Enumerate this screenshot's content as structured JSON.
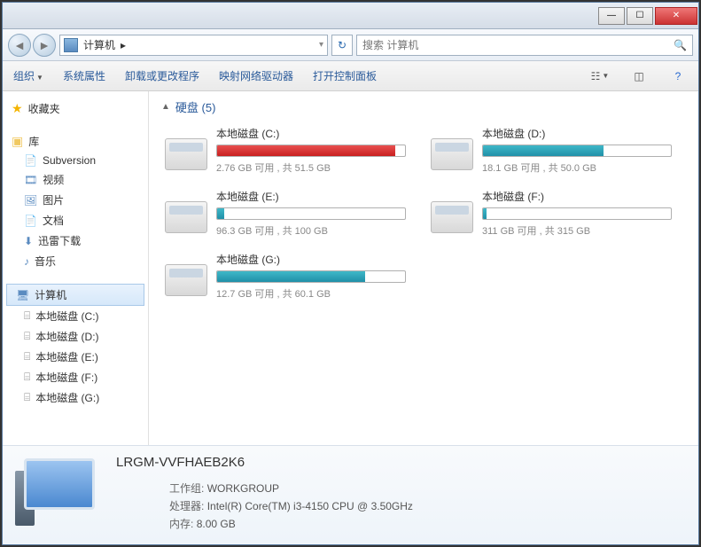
{
  "titlebar": {
    "min": "—",
    "max": "☐",
    "close": "✕"
  },
  "nav": {
    "address_icon": "computer",
    "address_text": "计算机",
    "address_sep": "▸",
    "refresh": "↻",
    "search_placeholder": "搜索 计算机"
  },
  "toolbar": {
    "organize": "组织",
    "properties": "系统属性",
    "uninstall": "卸载或更改程序",
    "map_drive": "映射网络驱动器",
    "control_panel": "打开控制面板"
  },
  "sidebar": {
    "favorites": "收藏夹",
    "libraries": "库",
    "lib_items": [
      {
        "label": "Subversion",
        "icon": "doc"
      },
      {
        "label": "视频",
        "icon": "video"
      },
      {
        "label": "图片",
        "icon": "pic"
      },
      {
        "label": "文档",
        "icon": "doc"
      },
      {
        "label": "迅雷下载",
        "icon": "dl"
      },
      {
        "label": "音乐",
        "icon": "music"
      }
    ],
    "computer": "计算机",
    "drives": [
      {
        "label": "本地磁盘 (C:)"
      },
      {
        "label": "本地磁盘 (D:)"
      },
      {
        "label": "本地磁盘 (E:)"
      },
      {
        "label": "本地磁盘 (F:)"
      },
      {
        "label": "本地磁盘 (G:)"
      }
    ]
  },
  "main": {
    "section_label": "硬盘 (5)",
    "drives": [
      {
        "name": "本地磁盘 (C:)",
        "free": "2.76 GB",
        "total": "51.5 GB",
        "pct": 95,
        "color": "red"
      },
      {
        "name": "本地磁盘 (D:)",
        "free": "18.1 GB",
        "total": "50.0 GB",
        "pct": 64,
        "color": "teal"
      },
      {
        "name": "本地磁盘 (E:)",
        "free": "96.3 GB",
        "total": "100 GB",
        "pct": 4,
        "color": "teal"
      },
      {
        "name": "本地磁盘 (F:)",
        "free": "311 GB",
        "total": "315 GB",
        "pct": 2,
        "color": "teal"
      },
      {
        "name": "本地磁盘 (G:)",
        "free": "12.7 GB",
        "total": "60.1 GB",
        "pct": 79,
        "color": "teal"
      }
    ],
    "stats_tpl_mid": " 可用 , 共 "
  },
  "details": {
    "name": "LRGM-VVFHAEB2K6",
    "workgroup_label": "工作组:",
    "workgroup": "WORKGROUP",
    "cpu_label": "处理器:",
    "cpu": "Intel(R) Core(TM) i3-4150 CPU @ 3.50GHz",
    "ram_label": "内存:",
    "ram": "8.00 GB"
  }
}
